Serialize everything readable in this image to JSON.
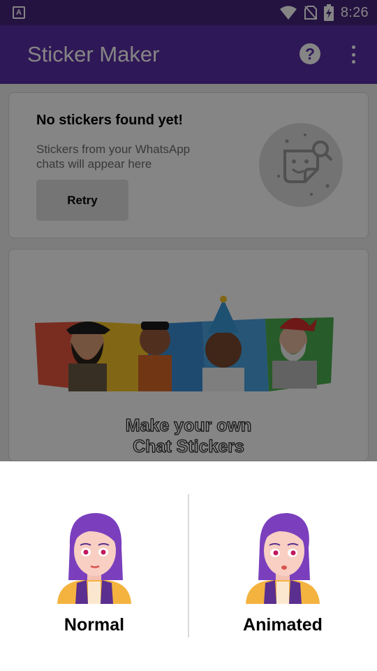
{
  "status_bar": {
    "time": "8:26",
    "left_icon_letter": "A",
    "icons": [
      "wifi-icon",
      "no-sim-icon",
      "battery-charging-icon"
    ]
  },
  "app_bar": {
    "title": "Sticker Maker",
    "help_icon": "help-circle-icon",
    "more_icon": "more-vert-icon",
    "help_glyph": "?"
  },
  "empty_card": {
    "heading": "No stickers found yet!",
    "description": "Stickers from your WhatsApp chats will appear here",
    "retry_label": "Retry",
    "art_icon": "sticker-search-icon"
  },
  "promo_card": {
    "headline_line1": "Make your own",
    "headline_line2": "Chat Stickers"
  },
  "bottom_sheet": {
    "options": [
      {
        "label": "Normal"
      },
      {
        "label": "Animated"
      }
    ]
  },
  "colors": {
    "primary": "#5b2fa7",
    "status_bar": "#45237d",
    "scrim": "rgba(0,0,0,0.48)"
  }
}
